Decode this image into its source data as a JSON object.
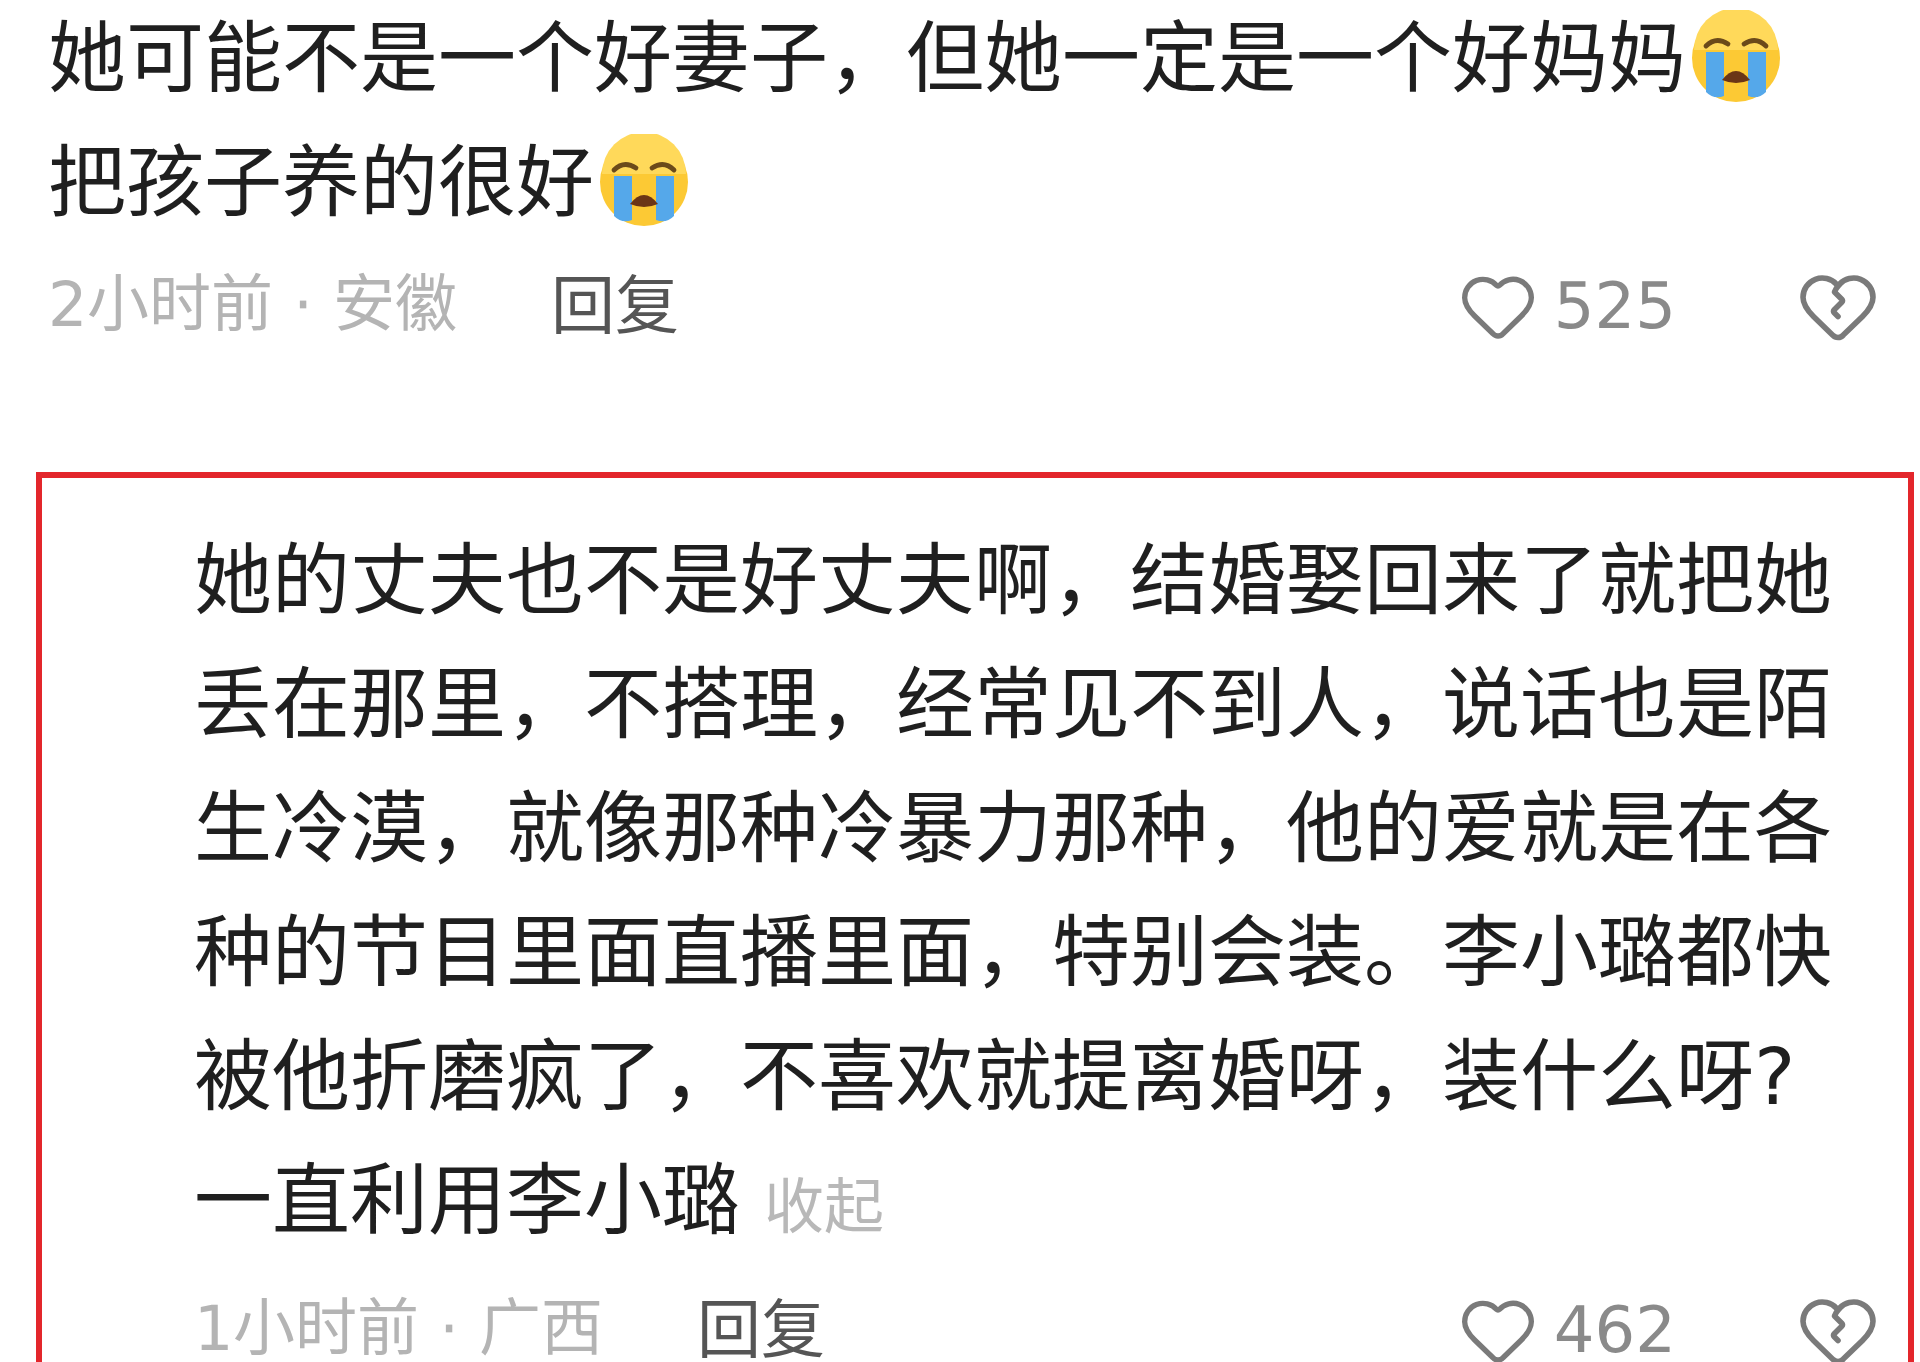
{
  "comments": [
    {
      "highlighted": false,
      "body": [
        {
          "text": "她可能不是一个好妻子，但她一定是一个好妈妈",
          "emoji": true
        },
        {
          "text": "把孩子养的很好",
          "emoji": true
        }
      ],
      "time_location": "2小时前 · 安徽",
      "reply": "回复",
      "likes": "525"
    },
    {
      "highlighted": true,
      "body": [
        {
          "text": "她的丈夫也不是好丈夫啊，结婚娶回来了就把她丢在那里，不搭理，经常见不到人，说话也是陌生冷漠，就像那种冷暴力那种，他的爱就是在各种的节目里面直播里面，特别会装。李小璐都快被他折磨疯了，不喜欢就提离婚呀，装什么呀?一直利用李小璐",
          "emoji": false
        }
      ],
      "collapse_link": "收起",
      "time_location": "1小时前 · 广西",
      "reply": "回复",
      "likes": "462"
    }
  ]
}
